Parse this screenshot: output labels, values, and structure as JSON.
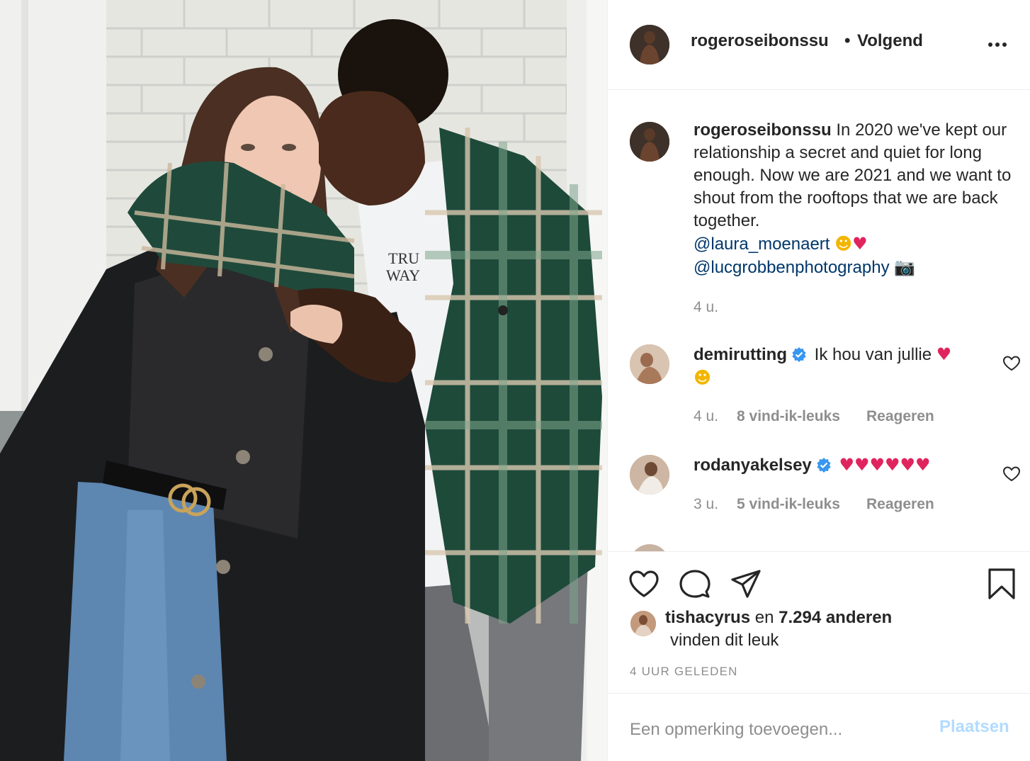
{
  "post": {
    "author": "rogeroseibonssu",
    "separator": "•",
    "follow_status": "Volgend",
    "caption_username": "rogeroseibonssu",
    "caption_text": "In 2020 we've kept our relationship a secret and quiet for long enough. Now we are 2021 and we want to shout from the rooftops that we are back together.",
    "mention_1": "@laura_moenaert",
    "mention_2": "@lucgrobbenphotography",
    "caption_time": "4 u."
  },
  "comments": [
    {
      "username": "demirutting",
      "verified": true,
      "text": "Ik hou van jullie",
      "time": "4 u.",
      "likes": "8 vind-ik-leuks",
      "reply": "Reageren"
    },
    {
      "username": "rodanyakelsey",
      "verified": true,
      "text": "",
      "time": "3 u.",
      "likes": "5 vind-ik-leuks",
      "reply": "Reageren"
    }
  ],
  "likes": {
    "liker": "tishacyrus",
    "joiner": "en",
    "others": "7.294 anderen",
    "suffix": "vinden dit leuk"
  },
  "timestamp": "4 UUR GELEDEN",
  "comment_box": {
    "placeholder": "Een opmerking toevoegen...",
    "post_label": "Plaatsen"
  },
  "icons": {
    "more": "more-options-icon",
    "like": "heart-outline-icon",
    "comment": "comment-bubble-icon",
    "share": "paper-plane-icon",
    "save": "bookmark-icon",
    "verified": "verified-badge-icon",
    "comment_like": "small-heart-icon"
  },
  "colors": {
    "link": "#00376b",
    "secondary_text": "#8e8e8e",
    "verified": "#3897f0",
    "post_button_disabled": "#b3dbff"
  }
}
